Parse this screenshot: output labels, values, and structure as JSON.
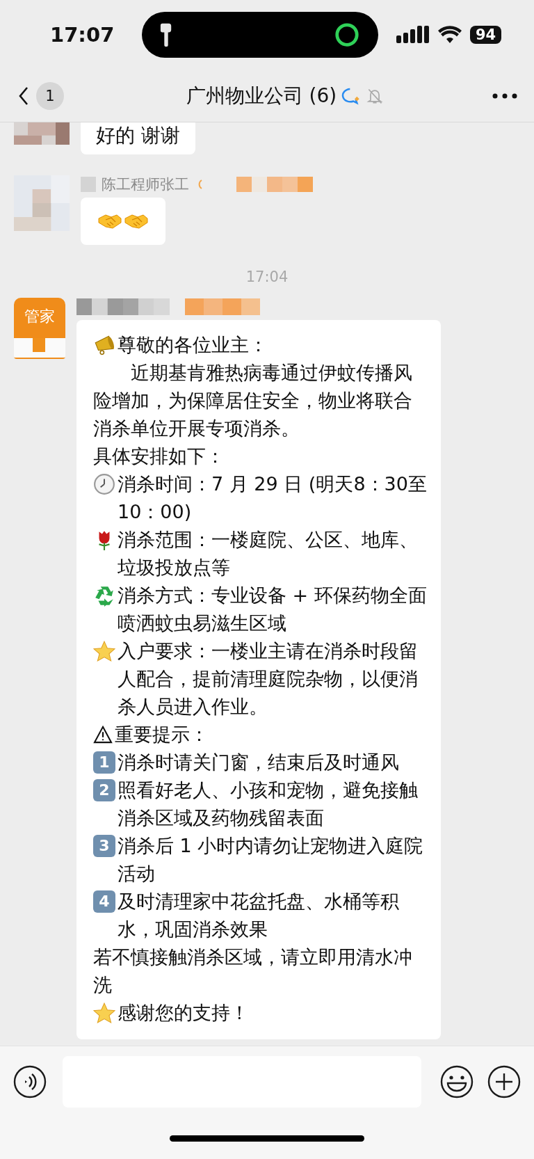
{
  "status_bar": {
    "time": "17:07",
    "battery": "94"
  },
  "nav": {
    "back_count": "1",
    "title": "广州物业公司 (6)",
    "muted": true
  },
  "messages": [
    {
      "kind": "text",
      "text": "好的 谢谢"
    },
    {
      "kind": "emoji",
      "sender": "陈工程师张工"
    },
    {
      "kind": "timestamp",
      "text": "17:04"
    },
    {
      "kind": "notice",
      "avatar_text": "管家",
      "lines": [
        {
          "kind": "megaphone",
          "text": "尊敬的各位业主："
        },
        {
          "kind": "plain",
          "indent": true,
          "text": "近期基肯雅热病毒通过伊蚊传播风险增加，为保障居住安全，物业将联合消杀单位开展专项消杀。"
        },
        {
          "kind": "plain",
          "indent": false,
          "text": "具体安排如下："
        },
        {
          "kind": "clock",
          "text": "消杀时间：7 月 29 日 (明天8：30至10：00)"
        },
        {
          "kind": "rose",
          "text": "消杀范围：一楼庭院、公区、地库、垃圾投放点等"
        },
        {
          "kind": "recycle",
          "text": "消杀方式：专业设备 + 环保药物全面喷洒蚊虫易滋生区域"
        },
        {
          "kind": "star",
          "text": "入户要求：一楼业主请在消杀时段留人配合，提前清理庭院杂物，以便消杀人员进入作业。"
        },
        {
          "kind": "warning",
          "text": "重要提示："
        },
        {
          "kind": "keycap",
          "number": "1",
          "text": "消杀时请关门窗，结束后及时通风"
        },
        {
          "kind": "keycap",
          "number": "2",
          "text": "照看好老人、小孩和宠物，避免接触消杀区域及药物残留表面"
        },
        {
          "kind": "keycap",
          "number": "3",
          "text": "消杀后 1 小时内请勿让宠物进入庭院活动"
        },
        {
          "kind": "keycap",
          "number": "4",
          "text": "及时清理家中花盆托盘、水桶等积水，巩固消杀效果"
        },
        {
          "kind": "plain",
          "indent": false,
          "text": "若不慎接触消杀区域，请立即用清水冲洗"
        },
        {
          "kind": "star",
          "text": "感谢您的支持！"
        }
      ]
    }
  ]
}
